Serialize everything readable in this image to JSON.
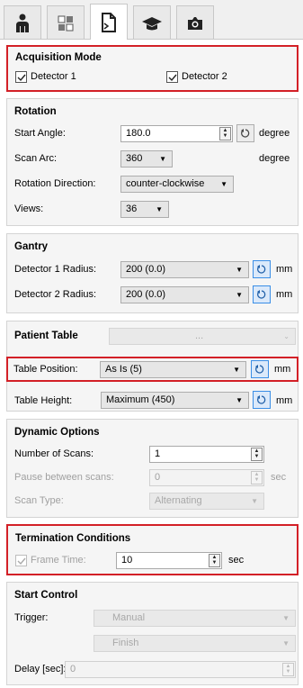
{
  "tabs": [
    {
      "icon": "person-icon"
    },
    {
      "icon": "grid-icon"
    },
    {
      "icon": "document-icon",
      "active": true
    },
    {
      "icon": "graduation-cap-icon"
    },
    {
      "icon": "camera-icon"
    }
  ],
  "acquisition": {
    "title": "Acquisition Mode",
    "detector1": {
      "label": "Detector 1",
      "checked": true
    },
    "detector2": {
      "label": "Detector 2",
      "checked": true
    }
  },
  "rotation": {
    "title": "Rotation",
    "start_angle_label": "Start Angle:",
    "start_angle_value": "180.0",
    "start_angle_unit": "degree",
    "scan_arc_label": "Scan Arc:",
    "scan_arc_value": "360",
    "scan_arc_unit": "degree",
    "direction_label": "Rotation Direction:",
    "direction_value": "counter-clockwise",
    "views_label": "Views:",
    "views_value": "36"
  },
  "gantry": {
    "title": "Gantry",
    "det1_label": "Detector 1 Radius:",
    "det1_value": "200 (0.0)",
    "det1_unit": "mm",
    "det2_label": "Detector 2 Radius:",
    "det2_value": "200 (0.0)",
    "det2_unit": "mm"
  },
  "patient_table": {
    "title": "Patient Table",
    "combo_value": "...",
    "position_label": "Table Position:",
    "position_value": "As Is (5)",
    "position_unit": "mm",
    "height_label": "Table Height:",
    "height_value": "Maximum (450)",
    "height_unit": "mm"
  },
  "dynamic": {
    "title": "Dynamic Options",
    "num_scans_label": "Number of Scans:",
    "num_scans_value": "1",
    "pause_label": "Pause between scans:",
    "pause_value": "0",
    "pause_unit": "sec",
    "scan_type_label": "Scan Type:",
    "scan_type_value": "Alternating"
  },
  "termination": {
    "title": "Termination Conditions",
    "frame_time_label": "Frame Time:",
    "frame_time_checked": true,
    "frame_time_value": "10",
    "frame_time_unit": "sec"
  },
  "start_control": {
    "title": "Start Control",
    "trigger_label": "Trigger:",
    "trigger_value": "Manual",
    "finish_value": "Finish",
    "delay_label": "Delay [sec]:",
    "delay_value": "0"
  },
  "colors": {
    "highlight": "#d32027",
    "accent": "#3a8ee6"
  }
}
